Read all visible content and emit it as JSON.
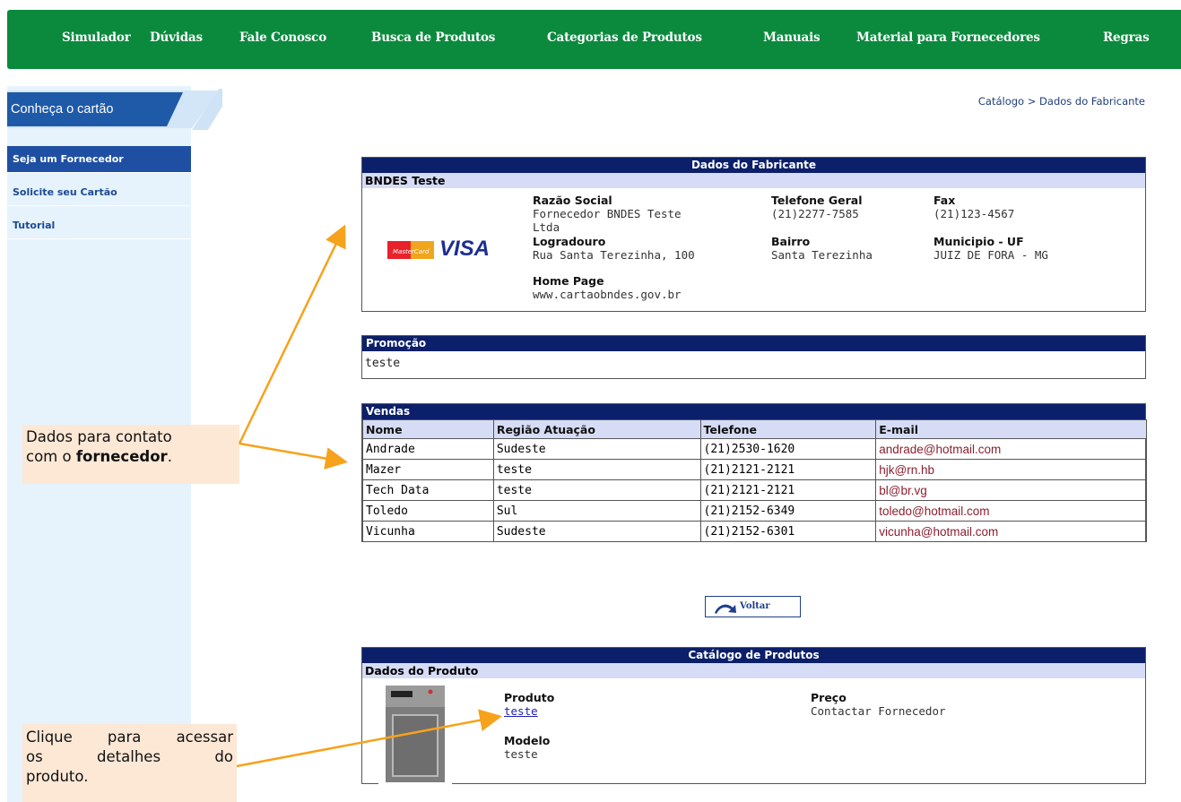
{
  "nav": [
    "Simulador",
    "Dúvidas",
    "Fale Conosco",
    "Busca de Produtos",
    "Categorias de Produtos",
    "Manuais",
    "Material para Fornecedores",
    "Regras"
  ],
  "sidebar": {
    "tab_label": "Conheça o cartão",
    "items": [
      {
        "label": "Seja um Fornecedor"
      },
      {
        "label": "Solicite seu Cartão"
      },
      {
        "label": "Tutorial"
      }
    ]
  },
  "breadcrumb": "Catálogo > Dados do Fabricante",
  "fabricante": {
    "title": "Dados do Fabricante",
    "name": "BNDES Teste",
    "razao_label": "Razão Social",
    "razao_value_1": "Fornecedor BNDES Teste",
    "razao_value_2": "Ltda",
    "tel_label": "Telefone Geral",
    "tel_value": "(21)2277-7585",
    "fax_label": "Fax",
    "fax_value": "(21)123-4567",
    "logradouro_label": "Logradouro",
    "logradouro_value": "Rua Santa Terezinha, 100",
    "bairro_label": "Bairro",
    "bairro_value": "Santa Terezinha",
    "municipio_label": "Municipio - UF",
    "municipio_value": "JUIZ DE FORA - MG",
    "homepage_label": "Home Page",
    "homepage_value": "www.cartaobndes.gov.br",
    "card_brand": "VISA"
  },
  "promocao": {
    "title": "Promoção",
    "text": "teste"
  },
  "vendas": {
    "title": "Vendas",
    "headers": [
      "Nome",
      "Região Atuação",
      "Telefone",
      "E-mail"
    ],
    "rows": [
      [
        "Andrade",
        "Sudeste",
        "(21)2530-1620",
        "andrade@hotmail.com"
      ],
      [
        "Mazer",
        "teste",
        "(21)2121-2121",
        "hjk@rn.hb"
      ],
      [
        "Tech Data",
        "teste",
        "(21)2121-2121",
        "bl@br.vg"
      ],
      [
        "Toledo",
        "Sul",
        "(21)2152-6349",
        "toledo@hotmail.com"
      ],
      [
        "Vicunha",
        "Sudeste",
        "(21)2152-6301",
        "vicunha@hotmail.com"
      ]
    ]
  },
  "voltar_label": "Voltar",
  "catalogo": {
    "title": "Catálogo de Produtos",
    "sub": "Dados do Produto",
    "produto_label": "Produto",
    "produto_value": "teste",
    "modelo_label": "Modelo",
    "modelo_value": "teste",
    "preco_label": "Preço",
    "preco_value": "Contactar Fornecedor"
  },
  "callouts": {
    "contato_1": "Dados para contato",
    "contato_2": "com o ",
    "contato_bold": "fornecedor",
    "contato_end": ".",
    "produto_1": "Clique para acessar",
    "produto_2": "os detalhes do",
    "produto_3": "produto."
  },
  "colors": {
    "nav_bg": "#0b8a3e",
    "header_bg": "#0b1f6a",
    "subheader_bg": "#d6dcf5",
    "sidebar_bg": "#e6f3fd",
    "accent_arrow": "#f7a21b",
    "callout_bg": "#fde8d6"
  }
}
